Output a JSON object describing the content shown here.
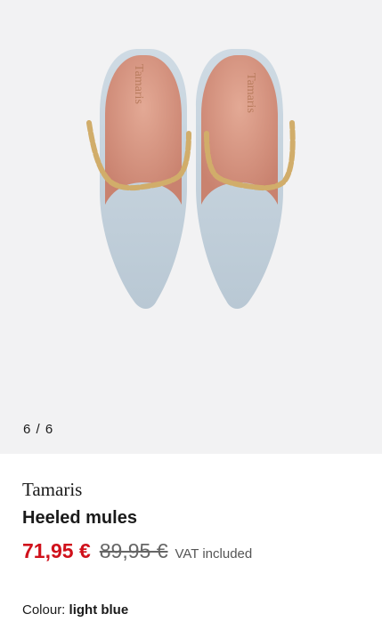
{
  "gallery": {
    "counter": "6 / 6",
    "image_alt": "Tamaris heeled mules, light blue, top view",
    "insole_logo": "Tamaris"
  },
  "product": {
    "brand": "Tamaris",
    "name": "Heeled mules",
    "price_current": "71,95 €",
    "price_original": "89,95 €",
    "vat_note": "VAT included",
    "colour_label": "Colour:",
    "colour_value": "light blue"
  },
  "colors": {
    "price_current": "#d0111b",
    "gallery_background": "#f2f2f3",
    "upper": "#c5d3de",
    "lining": "#d99a86"
  }
}
